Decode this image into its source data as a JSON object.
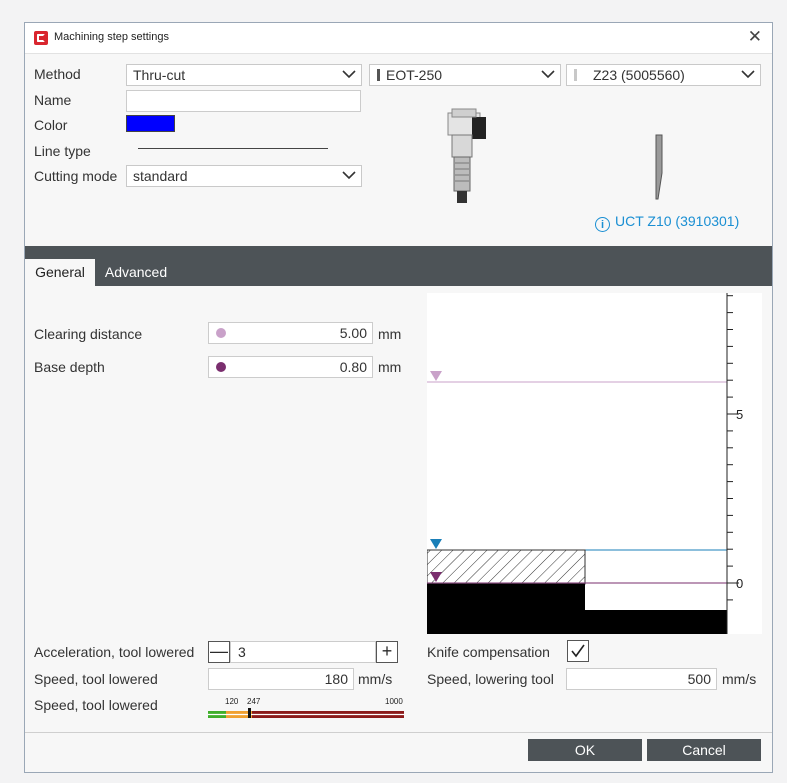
{
  "dialog": {
    "title": "Machining step settings",
    "close_glyph": "✕"
  },
  "settings": {
    "method_label": "Method",
    "method_value": "Thru-cut",
    "tool_value": "EOT-250",
    "blade_value": "Z23 (5005560)",
    "name_label": "Name",
    "name_value": "",
    "color_label": "Color",
    "color_value": "#0000ff",
    "line_type_label": "Line type",
    "cutting_mode_label": "Cutting mode",
    "cutting_mode_value": "standard",
    "info_link": "UCT Z10 (3910301)",
    "info_icon_glyph": "i"
  },
  "tabs": [
    {
      "label": "General"
    },
    {
      "label": "Advanced"
    }
  ],
  "general": {
    "clearing_distance_label": "Clearing distance",
    "clearing_distance_value": "5.00",
    "clearing_distance_unit": "mm",
    "clearing_dot_color": "#c9a1c9",
    "base_depth_label": "Base depth",
    "base_depth_value": "0.80",
    "base_depth_unit": "mm",
    "base_dot_color": "#7a2e6e",
    "accel_label": "Acceleration, tool lowered",
    "accel_value": "3",
    "minus_glyph": "—",
    "plus_glyph": "+",
    "speed_lowered_label": "Speed, tool lowered",
    "speed_lowered_value": "180",
    "speed_lowered_unit": "mm/s",
    "speed_bar_label": "Speed, tool lowered",
    "speed_bar_ticks": [
      "120",
      "247",
      "1000"
    ],
    "speed_bar_marker": 247,
    "speed_bar_max": 1000,
    "knife_comp_label": "Knife compensation",
    "knife_comp_checked": true,
    "lowering_speed_label": "Speed, lowering tool",
    "lowering_speed_value": "500",
    "lowering_speed_unit": "mm/s"
  },
  "preview": {
    "scale_labels": [
      "5",
      "0"
    ],
    "clearing_distance_mm": 5.0,
    "base_depth_mm": 0.8,
    "clearing_color": "#c9a1c9",
    "base_color": "#7a2e6e",
    "surface_color": "#1a7fb8"
  },
  "footer": {
    "ok_label": "OK",
    "cancel_label": "Cancel"
  }
}
